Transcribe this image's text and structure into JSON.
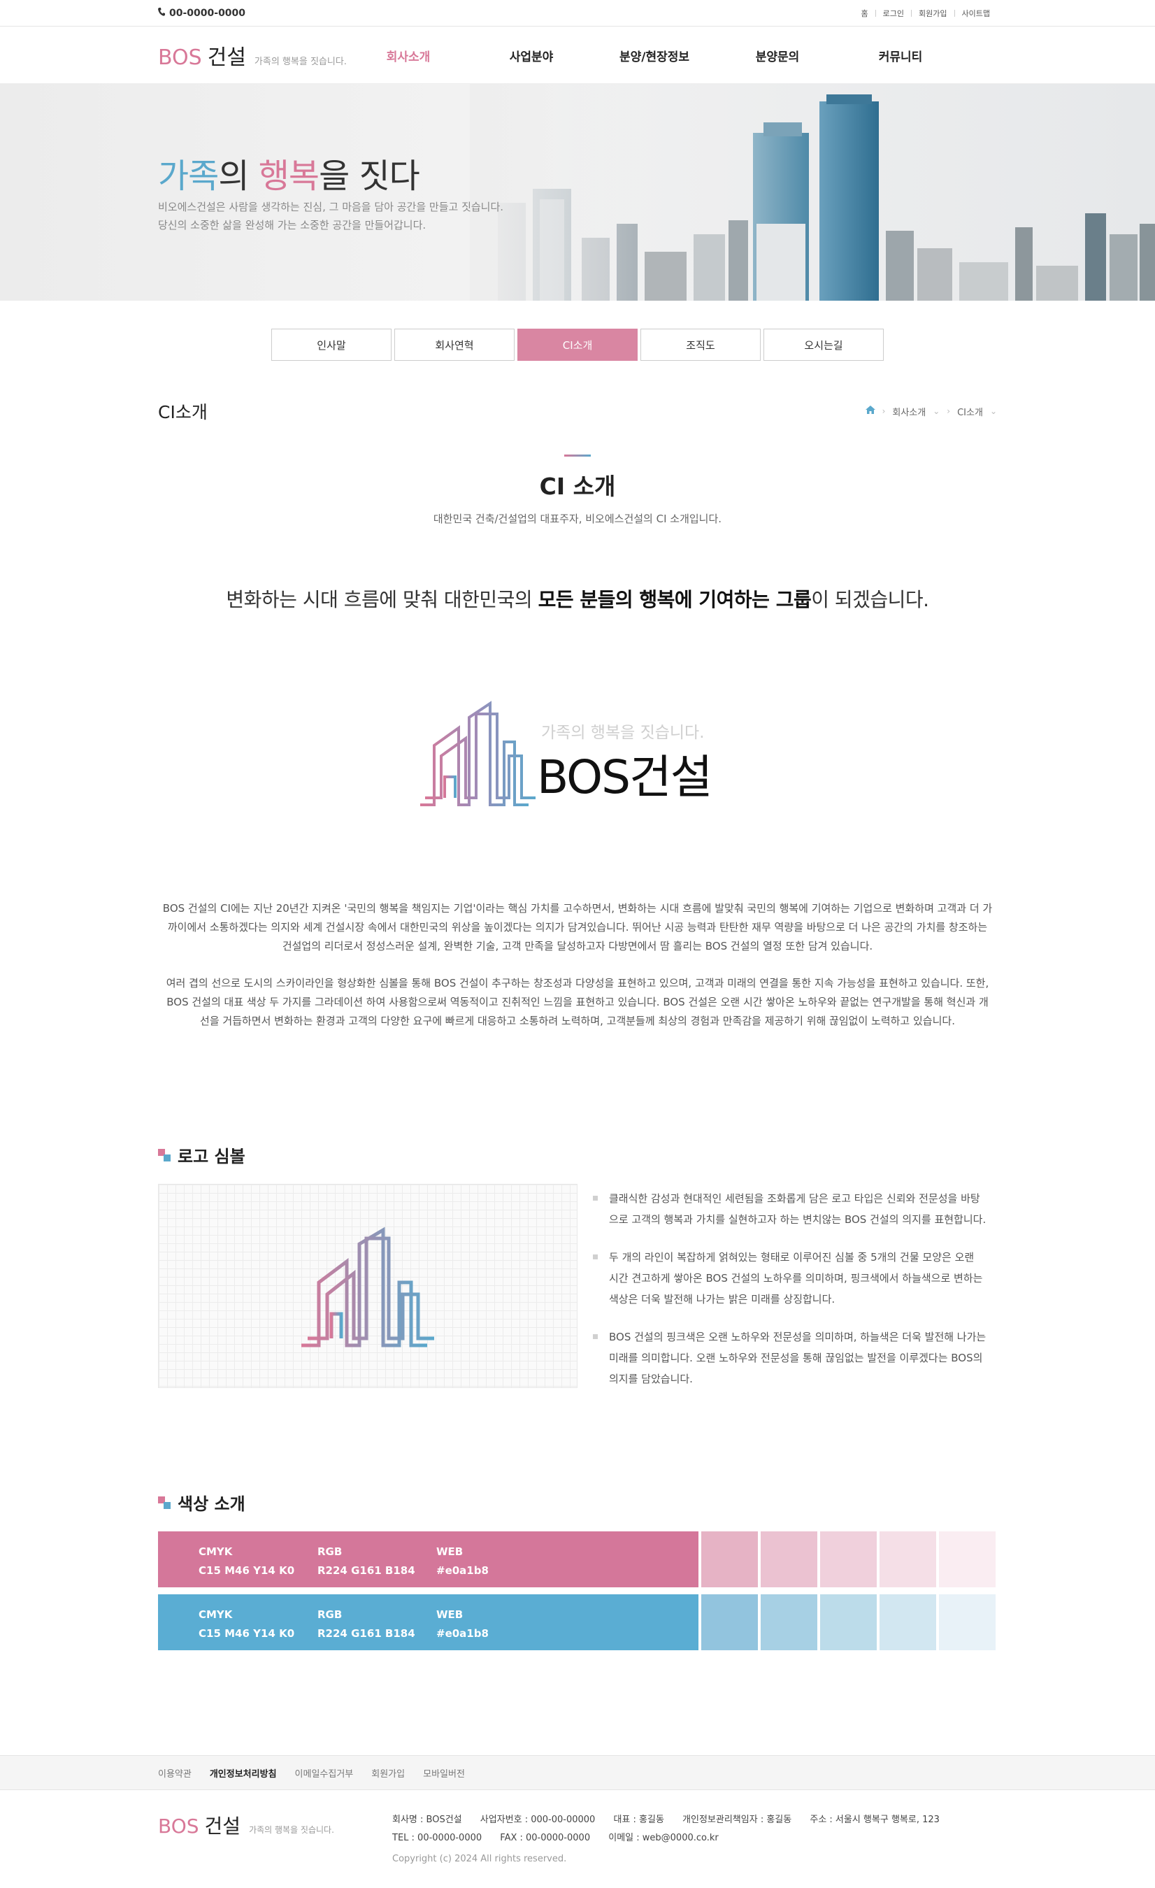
{
  "topbar": {
    "phone": "00-0000-0000",
    "links": [
      "홈",
      "로그인",
      "회원가입",
      "사이트맵"
    ]
  },
  "header": {
    "logo_bos": "BOS",
    "logo_kr": "건설",
    "slogan": "가족의 행복을 짓습니다.",
    "nav": [
      "회사소개",
      "사업분야",
      "분양/현장정보",
      "분양문의",
      "커뮤니티"
    ]
  },
  "hero": {
    "title_part1": "가족",
    "title_part2": "의 ",
    "title_part3": "행복",
    "title_part4": "을 짓다",
    "line1": "비오에스건설은 사람을 생각하는 진심, 그 마음을 담아 공간을 만들고 짓습니다.",
    "line2": "당신의 소중한 삶을 완성해 가는 소중한 공간을 만들어갑니다."
  },
  "subtabs": [
    "인사말",
    "회사연혁",
    "CI소개",
    "조직도",
    "오시는길"
  ],
  "page": {
    "title": "CI소개",
    "breadcrumb": [
      "회사소개",
      "CI소개"
    ]
  },
  "ci_section": {
    "heading": "CI 소개",
    "subheading": "대한민국 건축/건설업의 대표주자, 비오에스건설의 CI 소개입니다.",
    "tagline_pre": "변화하는 시대 흐름에 맞춰 대한민국의 ",
    "tagline_bold": "모든 분들의 행복에 기여하는 그룹",
    "tagline_post": "이 되겠습니다.",
    "logo_slogan": "가족의 행복을 짓습니다.",
    "logo_text": "BOS건설",
    "para1_l1": "BOS 건설의 CI에는 지난 20년간 지켜온 '국민의 행복을 책임지는 기업'이라는 핵심 가치를 고수하면서, 변화하는 시대 흐름에 발맞춰 국민의 행복에 기여하는 기업으로 변화하며 고객과 더 가",
    "para1_l2": "까이에서 소통하겠다는 의지와 세계 건설시장 속에서 대한민국의 위상을 높이겠다는 의지가 담겨있습니다. 뛰어난 시공 능력과 탄탄한 재무 역량을 바탕으로 더 나은 공간의 가치를 창조하는",
    "para1_l3": "건설업의 리더로서 정성스러운 설계, 완벽한 기술, 고객 만족을 달성하고자 다방면에서 땀 흘리는 BOS 건설의 열정 또한 담겨 있습니다.",
    "para2_l1": "여러 겹의 선으로 도시의 스카이라인을 형상화한 심볼을 통해 BOS 건설이 추구하는 창조성과 다양성을 표현하고 있으며, 고객과 미래의 연결을 통한 지속 가능성을 표현하고 있습니다. 또한,",
    "para2_l2": "BOS 건설의 대표 색상 두 가지를 그라데이션 하여 사용함으로써 역동적이고 진취적인 느낌을 표현하고 있습니다. BOS 건설은 오랜 시간 쌓아온 노하우와 끝없는 연구개발을 통해 혁신과 개",
    "para2_l3": "선을 거듭하면서 변화하는 환경과 고객의 다양한 요구에 빠르게 대응하고 소통하려 노력하며, 고객분들께 최상의 경험과 만족감을 제공하기 위해 끊임없이 노력하고 있습니다."
  },
  "symbol_section": {
    "heading": "로고 심볼",
    "bullets": [
      [
        "클래식한 감성과 현대적인 세련됨을 조화롭게 담은 로고 타입은 신뢰와 전문성을 바탕",
        "으로 고객의 행복과 가치를 실현하고자 하는 변치않는 BOS 건설의 의지를 표현합니다."
      ],
      [
        "두 개의 라인이 복잡하게 얽혀있는 형태로 이루어진 심볼 중 5개의 건물 모양은 오랜",
        "시간 견고하게 쌓아온 BOS 건설의 노하우를 의미하며, 핑크색에서 하늘색으로 변하는",
        "색상은 더욱 발전해 나가는 밝은 미래를 상징합니다."
      ],
      [
        "BOS 건설의 핑크색은 오랜 노하우와 전문성을 의미하며, 하늘색은 더욱 발전해 나가는",
        "미래를 의미합니다. 오랜 노하우와 전문성을 통해 끊임없는 발전을 이루겠다는 BOS의",
        "의지를 담았습니다."
      ]
    ]
  },
  "color_section": {
    "heading": "색상 소개",
    "rows": [
      {
        "main_color": "#d4779a",
        "cmyk_label": "CMYK",
        "cmyk": "C15 M46 Y14 K0",
        "rgb_label": "RGB",
        "rgb": "R224 G161 B184",
        "web_label": "WEB",
        "web": "#e0a1b8",
        "tints": [
          "#e6b3c5",
          "#ebc2d1",
          "#f0d0dc",
          "#f5dfe7",
          "#faedf2"
        ]
      },
      {
        "main_color": "#5aadd3",
        "cmyk_label": "CMYK",
        "cmyk": "C15 M46 Y14 K0",
        "rgb_label": "RGB",
        "rgb": "R224 G161 B184",
        "web_label": "WEB",
        "web": "#e0a1b8",
        "tints": [
          "#92c4de",
          "#a7d0e4",
          "#bcdcea",
          "#d2e7f1",
          "#e8f2f8"
        ]
      }
    ]
  },
  "footer": {
    "links": [
      "이용약관",
      "개인정보처리방침",
      "이메일수집거부",
      "회원가입",
      "모바일버전"
    ],
    "company": "회사명 : BOS건설",
    "bizno": "사업자번호 : 000-00-00000",
    "ceo": "대표 : 홍길동",
    "privacy_officer": "개인정보관리책임자 : 홍길동",
    "address": "주소 : 서울시 행복구 행복로, 123",
    "tel": "TEL : 00-0000-0000",
    "fax": "FAX : 00-0000-0000",
    "email": "이메일 : web@0000.co.kr",
    "copyright": "Copyright (c) 2024 All rights reserved."
  },
  "colors": {
    "brand_pink": "#d87898",
    "brand_blue": "#5aa8cc",
    "tab_active": "#d986a2"
  }
}
